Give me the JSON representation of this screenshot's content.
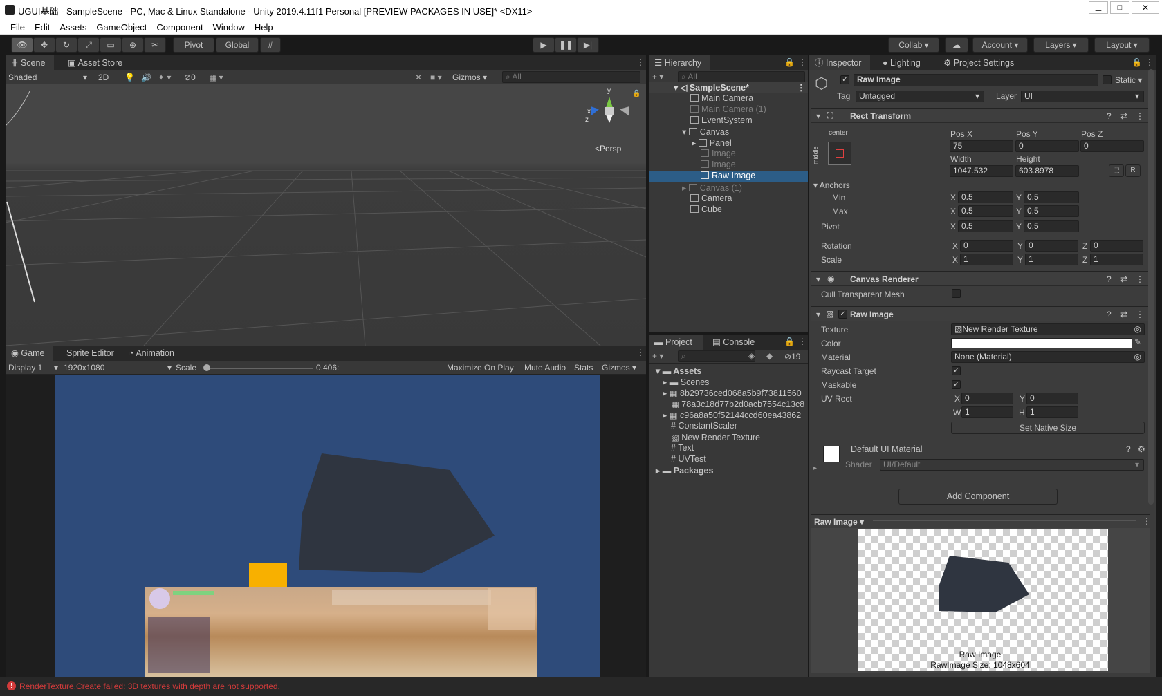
{
  "window": {
    "title": "UGUI基础 - SampleScene - PC, Mac & Linux Standalone - Unity 2019.4.11f1 Personal [PREVIEW PACKAGES IN USE]* <DX11>"
  },
  "menu": [
    "File",
    "Edit",
    "Assets",
    "GameObject",
    "Component",
    "Window",
    "Help"
  ],
  "toolbar": {
    "pivot": "Pivot",
    "global": "Global",
    "collab": "Collab",
    "account": "Account",
    "layers": "Layers",
    "layout": "Layout"
  },
  "scene": {
    "tabs": [
      "Scene",
      "Asset Store"
    ],
    "shading": "Shaded",
    "mode2d": "2D",
    "hidden_count": "0",
    "gizmos": "Gizmos",
    "search_placeholder": "All",
    "persp": "<Persp",
    "axis_y": "y",
    "axis_x": "x",
    "axis_z": "z"
  },
  "game": {
    "tabs": [
      "Game",
      "Sprite Editor",
      "Animation"
    ],
    "display": "Display 1",
    "resolution": "1920x1080",
    "scale_label": "Scale",
    "scale_value": "0.406:",
    "buttons": [
      "Maximize On Play",
      "Mute Audio",
      "Stats",
      "Gizmos"
    ]
  },
  "hierarchy": {
    "tab": "Hierarchy",
    "search_placeholder": "All",
    "scene_name": "SampleScene*",
    "items": [
      "Main Camera",
      "Main Camera (1)",
      "EventSystem",
      "Canvas",
      "Panel",
      "Image",
      "Image",
      "Raw Image",
      "Canvas (1)",
      "Camera",
      "Cube"
    ]
  },
  "project": {
    "tabs": [
      "Project",
      "Console"
    ],
    "hidden_count": "19",
    "items": [
      "Assets",
      "Scenes",
      "8b29736ced068a5b9f73811560",
      "78a3c18d77b2d0acb7554c13c8",
      "c96a8a50f52144ccd60ea43862",
      "ConstantScaler",
      "New Render Texture",
      "Text",
      "UVTest",
      "Packages"
    ]
  },
  "inspector": {
    "tabs": [
      "Inspector",
      "Lighting",
      "Project Settings"
    ],
    "object_name": "Raw Image",
    "static_label": "Static",
    "tag_label": "Tag",
    "tag_value": "Untagged",
    "layer_label": "Layer",
    "layer_value": "UI",
    "rect_transform": {
      "title": "Rect Transform",
      "anchor_h": "center",
      "anchor_v": "middle",
      "pos_x_label": "Pos X",
      "pos_y_label": "Pos Y",
      "pos_z_label": "Pos Z",
      "pos_x": "75",
      "pos_y": "0",
      "pos_z": "0",
      "width_label": "Width",
      "height_label": "Height",
      "width": "1047.532",
      "height": "603.8978",
      "r_button": "R",
      "anchors_label": "Anchors",
      "min_label": "Min",
      "max_label": "Max",
      "min_x": "0.5",
      "min_y": "0.5",
      "max_x": "0.5",
      "max_y": "0.5",
      "pivot_label": "Pivot",
      "pivot_x": "0.5",
      "pivot_y": "0.5",
      "rotation_label": "Rotation",
      "rot_x": "0",
      "rot_y": "0",
      "rot_z": "0",
      "scale_label": "Scale",
      "scale_x": "1",
      "scale_y": "1",
      "scale_z": "1",
      "x": "X",
      "y": "Y",
      "z": "Z"
    },
    "canvas_renderer": {
      "title": "Canvas Renderer",
      "cull_label": "Cull Transparent Mesh"
    },
    "raw_image": {
      "title": "Raw Image",
      "texture_label": "Texture",
      "texture_value": "New Render Texture",
      "color_label": "Color",
      "material_label": "Material",
      "material_value": "None (Material)",
      "raycast_label": "Raycast Target",
      "maskable_label": "Maskable",
      "uvrect_label": "UV Rect",
      "uv_x": "0",
      "uv_y": "0",
      "uv_w": "1",
      "uv_h": "1",
      "w": "W",
      "h": "H",
      "set_native": "Set Native Size"
    },
    "material": {
      "name": "Default UI Material",
      "shader_label": "Shader",
      "shader_value": "UI/Default"
    },
    "add_component": "Add Component",
    "preview": {
      "title": "Raw Image",
      "caption1": "Raw Image",
      "caption2": "RawImage Size: 1048x604"
    }
  },
  "status": {
    "error": "RenderTexture.Create failed: 3D textures with depth are not supported."
  },
  "colors": {
    "game_bg": "#2e4b7a",
    "shape": "#2f3540",
    "orange": "#f8b000",
    "error": "#d33b3b",
    "selected": "#2c5d87"
  }
}
